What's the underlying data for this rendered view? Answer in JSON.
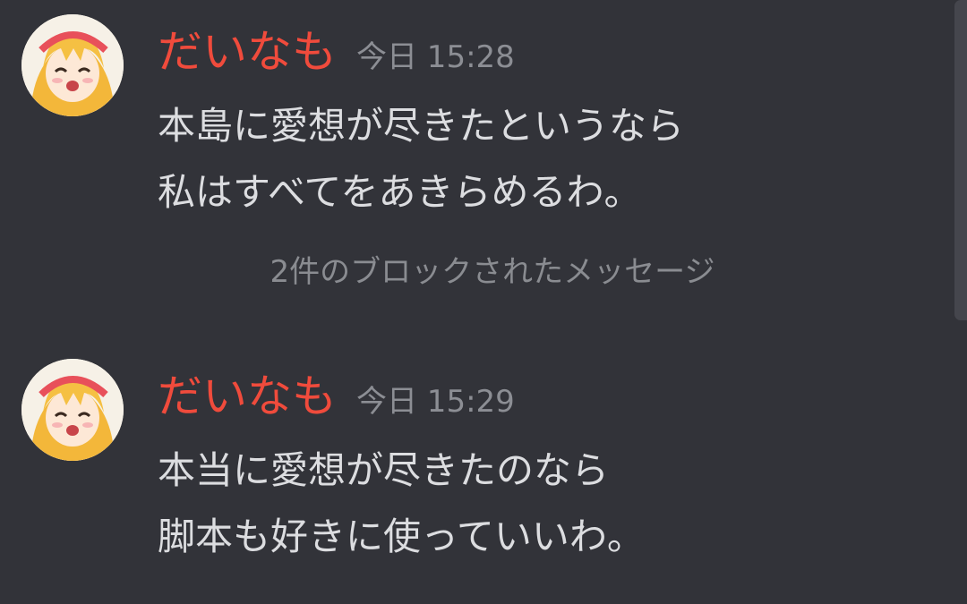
{
  "colors": {
    "background": "#323339",
    "author": "#f04b3c",
    "timestamp": "#8c8e94",
    "message_text": "#dcdde0",
    "system_text": "#8a8c91"
  },
  "messages": [
    {
      "author": "だいなも",
      "timestamp": "今日 15:28",
      "lines": [
        "本島に愛想が尽きたというなら",
        "私はすべてをあきらめるわ。"
      ]
    },
    {
      "author": "だいなも",
      "timestamp": "今日 15:29",
      "lines": [
        "本当に愛想が尽きたのなら",
        "脚本も好きに使っていいわ。"
      ]
    }
  ],
  "blocked_notice": "2件のブロックされたメッセージ"
}
